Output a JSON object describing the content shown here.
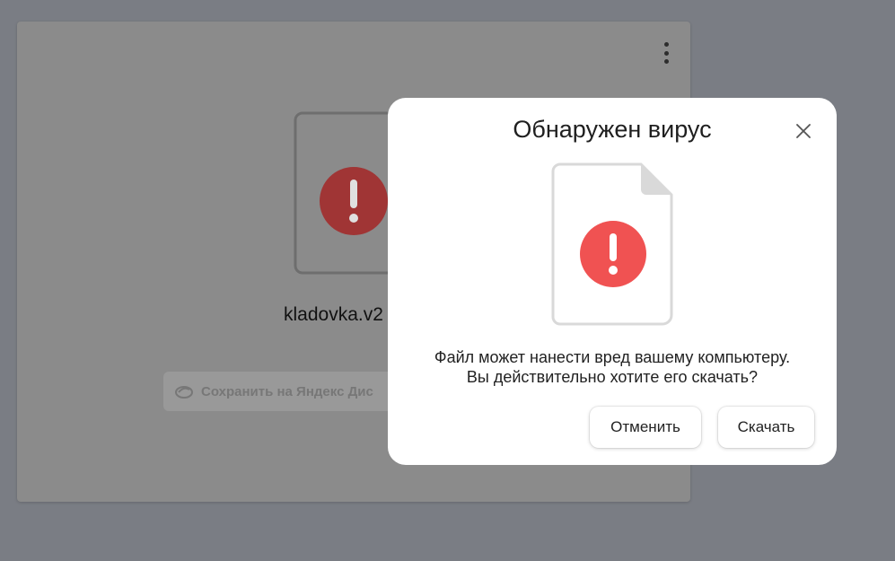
{
  "background_card": {
    "file_name": "kladovka.v2",
    "save_button_label": "Сохранить на Яндекс Дис",
    "more_icon": "vertical-dots-icon",
    "file_icon": "file-warning-icon"
  },
  "dialog": {
    "title": "Обнаружен вирус",
    "close_icon": "close-icon",
    "file_icon": "file-warning-icon",
    "message_line1": "Файл может нанести вред вашему компьютеру.",
    "message_line2": "Вы действительно хотите его скачать?",
    "cancel_label": "Отменить",
    "download_label": "Скачать"
  },
  "colors": {
    "overlay_background": "#7a7d84",
    "warning_red": "#f05252",
    "warning_red_dim": "#a03535",
    "dialog_background": "#ffffff"
  }
}
